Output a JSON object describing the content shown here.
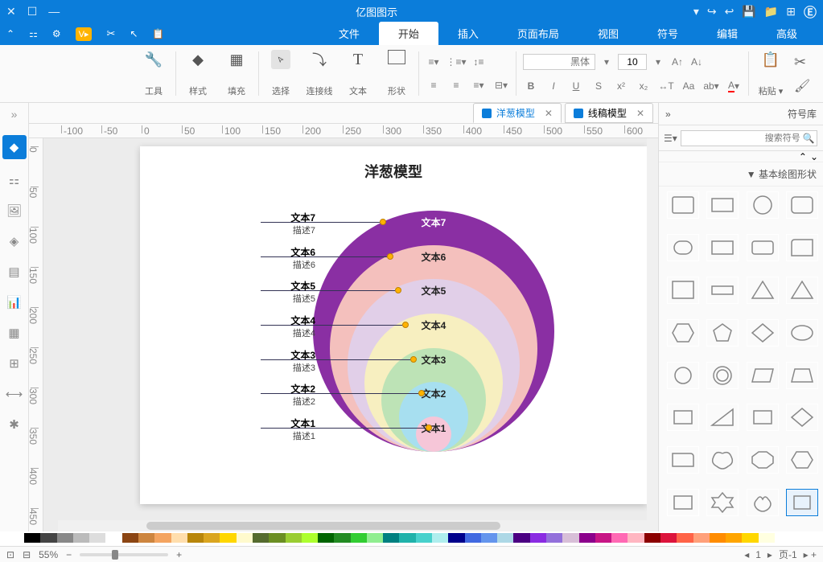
{
  "window": {
    "title": "亿图图示"
  },
  "menu": {
    "file": "文件",
    "start": "开始",
    "insert": "插入",
    "layout": "页面布局",
    "view": "视图",
    "symbol": "符号",
    "edit": "编辑",
    "advanced": "高级"
  },
  "ribbon": {
    "font_placeholder": "黑体",
    "font_size": "10",
    "tools": "工具",
    "style": "样式",
    "fill": "填充",
    "select": "选择",
    "connect": "连接线",
    "text": "文本",
    "shape": "形状"
  },
  "tabs": {
    "t1": "线稿模型",
    "t2": "洋葱模型"
  },
  "diagram": {
    "title": "洋葱模型",
    "rings": [
      {
        "label": "文本1",
        "desc": "描述1",
        "color": "#f6c6d8"
      },
      {
        "label": "文本2",
        "desc": "描述2",
        "color": "#a7dff0"
      },
      {
        "label": "文本3",
        "desc": "描述3",
        "color": "#bde3b6"
      },
      {
        "label": "文本4",
        "desc": "描述4",
        "color": "#f7efc0"
      },
      {
        "label": "文本5",
        "desc": "描述5",
        "color": "#e1cfe8"
      },
      {
        "label": "文本6",
        "desc": "描述6",
        "color": "#f4c0bd"
      },
      {
        "label": "文本7",
        "desc": "描述7",
        "color": "#8a2fa3"
      }
    ]
  },
  "rightpanel": {
    "title": "符号库",
    "search": "搜索符号",
    "section": "基本绘图形状"
  },
  "status": {
    "page": "页-1",
    "pagenum": "1",
    "zoom": "55%"
  },
  "colors": [
    "#000",
    "#444",
    "#888",
    "#bbb",
    "#ddd",
    "#fff",
    "#8b4513",
    "#cd853f",
    "#f4a460",
    "#ffdead",
    "#b8860b",
    "#daa520",
    "#ffd700",
    "#fffacd",
    "#556b2f",
    "#6b8e23",
    "#9acd32",
    "#adff2f",
    "#006400",
    "#228b22",
    "#32cd32",
    "#90ee90",
    "#008080",
    "#20b2aa",
    "#48d1cc",
    "#afeeee",
    "#00008b",
    "#4169e1",
    "#6495ed",
    "#add8e6",
    "#4b0082",
    "#8a2be2",
    "#9370db",
    "#d8bfd8",
    "#8b008b",
    "#c71585",
    "#ff69b4",
    "#ffb6c1",
    "#8b0000",
    "#dc143c",
    "#ff6347",
    "#ffa07a",
    "#ff8c00",
    "#ffa500",
    "#ffd700",
    "#ffffe0"
  ]
}
